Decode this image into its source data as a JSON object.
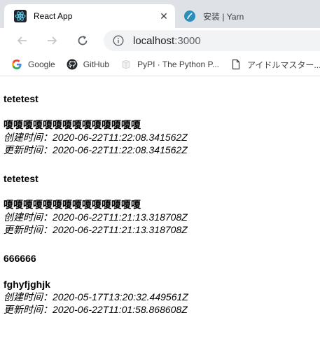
{
  "browser": {
    "tabs": [
      {
        "title": "React App",
        "icon": "react-icon"
      },
      {
        "title": "安装 | Yarn",
        "icon": "yarn-icon"
      }
    ],
    "url_host": "localhost",
    "url_port": ":3000",
    "bookmarks": [
      {
        "label": "Google",
        "icon": "google-icon"
      },
      {
        "label": "GitHub",
        "icon": "github-icon"
      },
      {
        "label": "PyPI · The Python P...",
        "icon": "pypi-icon"
      },
      {
        "label": "アイドルマスター...",
        "icon": "page-icon"
      }
    ]
  },
  "posts": [
    {
      "title": "tetetest",
      "body": "嗄嗄嗄嗄嗄嗄嗄嗄嗄嗄嗄嗄嗄嗄",
      "created": "创建时间：2020-06-22T11:22:08.341562Z",
      "updated": "更新时间：2020-06-22T11:22:08.341562Z"
    },
    {
      "title": "tetetest",
      "body": "嗄嗄嗄嗄嗄嗄嗄嗄嗄嗄嗄嗄嗄嗄",
      "created": "创建时间：2020-06-22T11:21:13.318708Z",
      "updated": "更新时间：2020-06-22T11:21:13.318708Z"
    },
    {
      "title": "666666",
      "body": "fghyfjghjk",
      "created": "创建时间：2020-05-17T13:20:32.449561Z",
      "updated": "更新时间：2020-06-22T11:01:58.868608Z"
    }
  ]
}
